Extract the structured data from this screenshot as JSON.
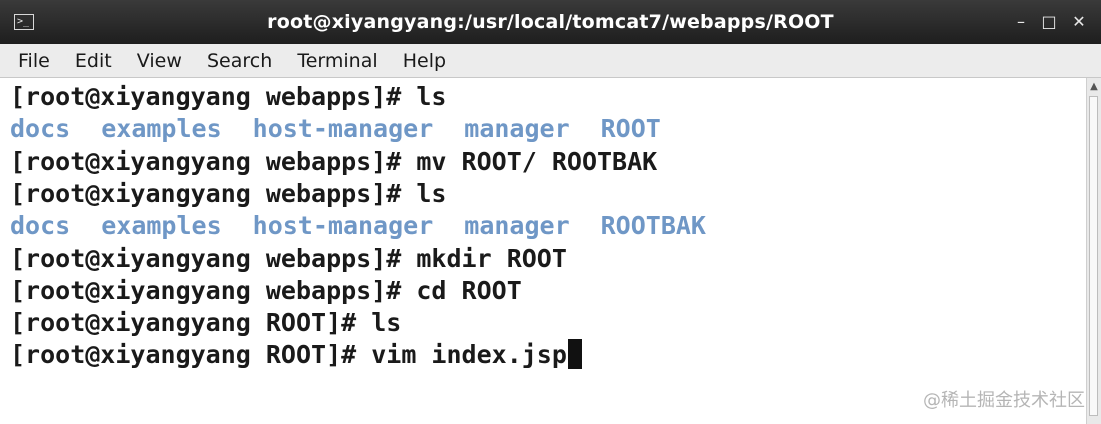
{
  "window": {
    "title": "root@xiyangyang:/usr/local/tomcat7/webapps/ROOT",
    "icon": "terminal-icon",
    "minimize": "–",
    "maximize": "□",
    "close": "✕"
  },
  "menu": [
    "File",
    "Edit",
    "View",
    "Search",
    "Terminal",
    "Help"
  ],
  "terminal": {
    "lines": [
      {
        "type": "cmd",
        "text": "[root@xiyangyang webapps]# ls"
      },
      {
        "type": "ls",
        "items": [
          "docs",
          "examples",
          "host-manager",
          "manager",
          "ROOT"
        ]
      },
      {
        "type": "cmd",
        "text": "[root@xiyangyang webapps]# mv ROOT/ ROOTBAK"
      },
      {
        "type": "cmd",
        "text": "[root@xiyangyang webapps]# ls"
      },
      {
        "type": "ls",
        "items": [
          "docs",
          "examples",
          "host-manager",
          "manager",
          "ROOTBAK"
        ]
      },
      {
        "type": "cmd",
        "text": "[root@xiyangyang webapps]# mkdir ROOT"
      },
      {
        "type": "cmd",
        "text": "[root@xiyangyang webapps]# cd ROOT"
      },
      {
        "type": "cmd",
        "text": "[root@xiyangyang ROOT]# ls"
      },
      {
        "type": "cmd",
        "text": "[root@xiyangyang ROOT]# vim index.jsp",
        "cursor": true
      }
    ],
    "directory_color": "#6f97c6",
    "text_color": "#1a1a1a"
  },
  "watermark": "@稀土掘金技术社区"
}
